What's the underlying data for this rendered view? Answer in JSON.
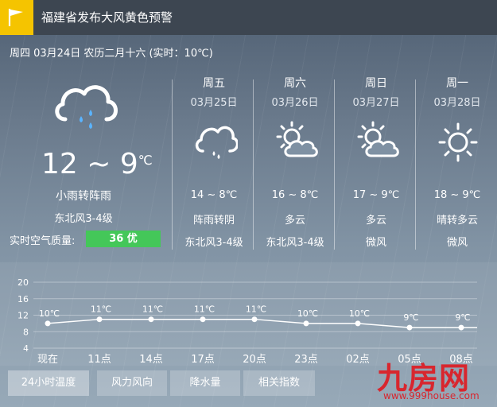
{
  "alert": {
    "text": "福建省发布大风黄色预警",
    "flag_color": "#f5c400"
  },
  "date_line": "周四 03月24日 农历二月十六 (实时：10℃)",
  "today": {
    "icon": "light-rain-cloud-icon",
    "temp": "12 ~ 9",
    "unit": "℃",
    "desc": "小雨转阵雨",
    "wind": "东北风3-4级",
    "aqi_label": "实时空气质量:",
    "aqi_value": "36 优",
    "aqi_color": "#44c759"
  },
  "forecast": [
    {
      "day": "周五",
      "date": "03月25日",
      "icon": "shower-cloud-icon",
      "temp": "14 ~ 8℃",
      "desc": "阵雨转阴",
      "wind": "东北风3-4级"
    },
    {
      "day": "周六",
      "date": "03月26日",
      "icon": "partly-cloudy-icon",
      "temp": "16 ~ 8℃",
      "desc": "多云",
      "wind": "东北风3-4级"
    },
    {
      "day": "周日",
      "date": "03月27日",
      "icon": "partly-cloudy-icon",
      "temp": "17 ~ 9℃",
      "desc": "多云",
      "wind": "微风"
    },
    {
      "day": "周一",
      "date": "03月28日",
      "icon": "sun-icon",
      "temp": "18 ~ 9℃",
      "desc": "晴转多云",
      "wind": "微风"
    }
  ],
  "chart_data": {
    "type": "line",
    "categories": [
      "现在",
      "11点",
      "14点",
      "17点",
      "20点",
      "23点",
      "02点",
      "05点",
      "08点"
    ],
    "values": [
      10,
      11,
      11,
      11,
      11,
      10,
      10,
      9,
      9
    ],
    "point_labels": [
      "10℃",
      "11℃",
      "11℃",
      "11℃",
      "11℃",
      "10℃",
      "10℃",
      "9℃",
      "9℃"
    ],
    "yticks": [
      20,
      16,
      12,
      8,
      4
    ],
    "ylim": [
      4,
      20
    ],
    "grid": true
  },
  "tabs": [
    {
      "label": "24小时温度",
      "active": true
    },
    {
      "label": "风力风向",
      "active": false
    },
    {
      "label": "降水量",
      "active": false
    },
    {
      "label": "相关指数",
      "active": false
    }
  ],
  "watermark": {
    "logo": "九房网",
    "url": "www.999house.com",
    "color": "#d8262e"
  }
}
